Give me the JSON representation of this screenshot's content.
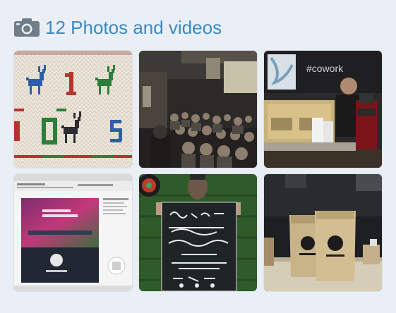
{
  "header": {
    "title": "12 Photos and videos",
    "icon": "camera-icon",
    "color": "#3b88c3"
  },
  "photos": [
    {
      "id": "photo-1",
      "scene": "knitted-pattern",
      "caption": ""
    },
    {
      "id": "photo-2",
      "scene": "audience-hall",
      "caption": ""
    },
    {
      "id": "photo-3",
      "scene": "coffee-bar",
      "caption": ""
    },
    {
      "id": "photo-4",
      "scene": "website-screenshot",
      "caption": ""
    },
    {
      "id": "photo-5",
      "scene": "chalkboard-poster",
      "caption": ""
    },
    {
      "id": "photo-6",
      "scene": "coffee-bags",
      "caption": ""
    }
  ]
}
